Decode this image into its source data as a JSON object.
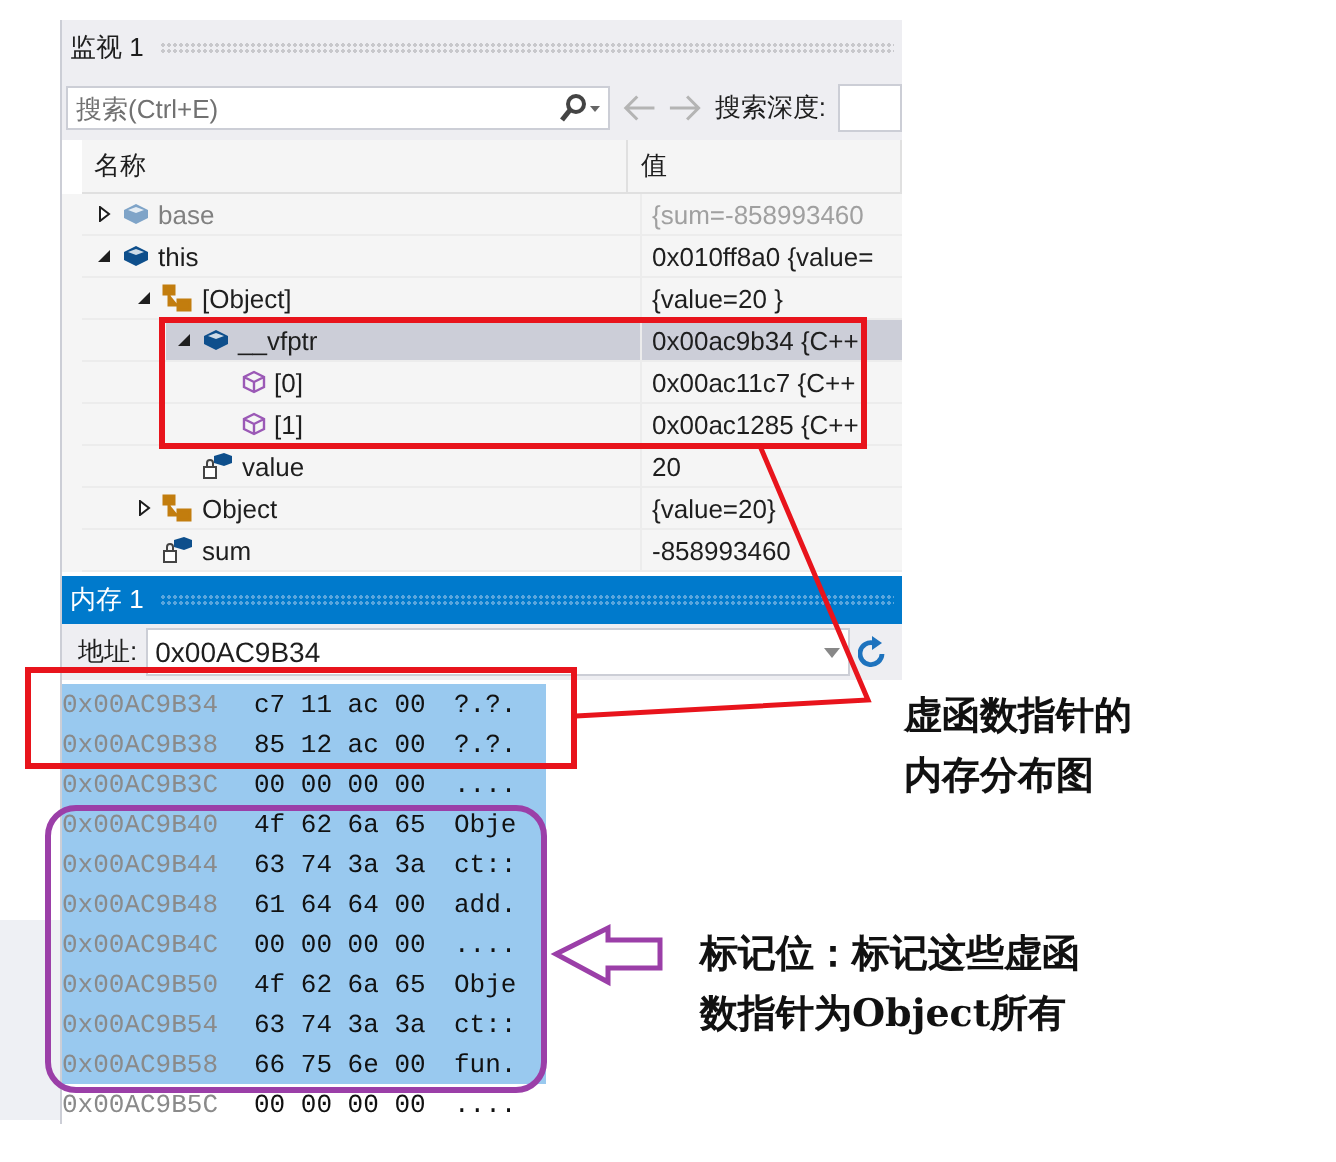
{
  "watch_window": {
    "title": "监视 1",
    "search": {
      "placeholder": "搜索(Ctrl+E)"
    },
    "search_depth_label": "搜索深度:",
    "columns": [
      "名称",
      "值"
    ],
    "rows": [
      {
        "name": "base",
        "value": "{sum=-858993460",
        "kind": "class",
        "expanded": false,
        "dimmed": true,
        "selected": false
      },
      {
        "name": "this",
        "value": "0x010ff8a0 {value=",
        "kind": "class",
        "expanded": true,
        "dimmed": false,
        "selected": false,
        "children": [
          {
            "name": "[Object]",
            "value": "{value=20 }",
            "kind": "base_class",
            "expanded": true,
            "dimmed": false,
            "selected": false,
            "children": [
              {
                "name": "__vfptr",
                "value": "0x00ac9b34 {C++",
                "kind": "class",
                "expanded": true,
                "dimmed": false,
                "selected": true,
                "children": [
                  {
                    "name": "[0]",
                    "value": "0x00ac11c7 {C++",
                    "kind": "method",
                    "dimmed": false,
                    "selected": false
                  },
                  {
                    "name": "[1]",
                    "value": "0x00ac1285 {C++",
                    "kind": "method",
                    "dimmed": false,
                    "selected": false
                  }
                ]
              },
              {
                "name": "value",
                "value": "20",
                "kind": "field",
                "dimmed": false,
                "selected": false
              }
            ]
          },
          {
            "name": "Object",
            "value": "{value=20}",
            "kind": "base_class",
            "expanded": false,
            "dimmed": false,
            "selected": false
          },
          {
            "name": "sum",
            "value": "-858993460",
            "kind": "field",
            "dimmed": false,
            "selected": false
          }
        ]
      }
    ]
  },
  "memory_window": {
    "title": "内存 1",
    "address_label": "地址:",
    "address": "0x00AC9B34",
    "rows": [
      {
        "address": "0x00AC9B34",
        "bytes": "c7 11 ac 00",
        "text": "?.?.",
        "selected": true
      },
      {
        "address": "0x00AC9B38",
        "bytes": "85 12 ac 00",
        "text": "?.?.",
        "selected": true
      },
      {
        "address": "0x00AC9B3C",
        "bytes": "00 00 00 00",
        "text": "....",
        "selected": true
      },
      {
        "address": "0x00AC9B40",
        "bytes": "4f 62 6a 65",
        "text": "Obje",
        "selected": true
      },
      {
        "address": "0x00AC9B44",
        "bytes": "63 74 3a 3a",
        "text": "ct::",
        "selected": true
      },
      {
        "address": "0x00AC9B48",
        "bytes": "61 64 64 00",
        "text": "add.",
        "selected": true
      },
      {
        "address": "0x00AC9B4C",
        "bytes": "00 00 00 00",
        "text": "....",
        "selected": true
      },
      {
        "address": "0x00AC9B50",
        "bytes": "4f 62 6a 65",
        "text": "Obje",
        "selected": true
      },
      {
        "address": "0x00AC9B54",
        "bytes": "63 74 3a 3a",
        "text": "ct::",
        "selected": true
      },
      {
        "address": "0x00AC9B58",
        "bytes": "66 75 6e 00",
        "text": "fun.",
        "selected": true
      },
      {
        "address": "0x00AC9B5C",
        "bytes": "00 00 00 00",
        "text": "....",
        "selected": false
      }
    ]
  },
  "annotations": [
    {
      "kind": "vtable_note",
      "text": "虚函数指针的内存分布图"
    },
    {
      "kind": "marker_note",
      "text": "标记位：标记这些虚函数指针为Object所有"
    }
  ]
}
